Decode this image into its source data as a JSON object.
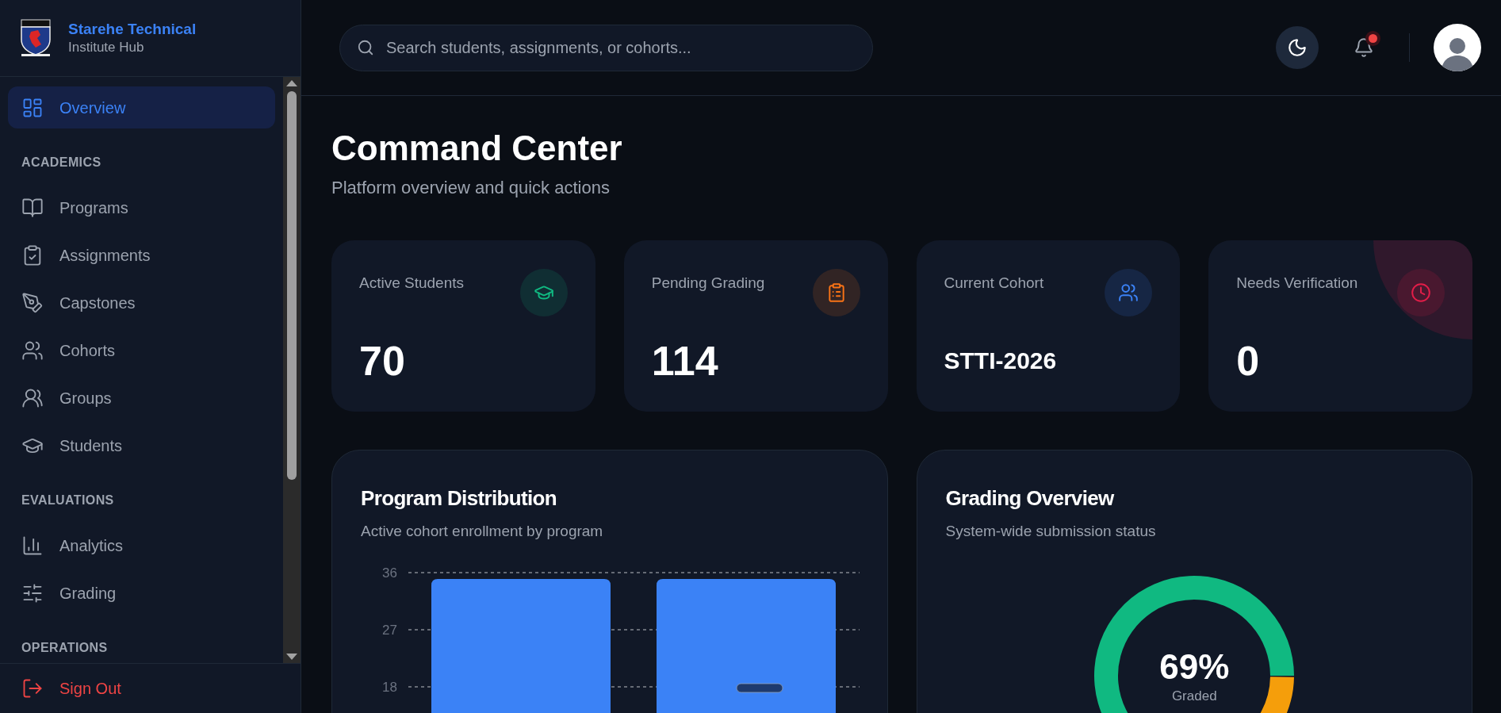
{
  "sidebar": {
    "brand": {
      "title": "Starehe Technical",
      "subtitle": "Institute Hub"
    },
    "nav": [
      {
        "kind": "item",
        "label": "Overview",
        "selected": true
      },
      {
        "kind": "heading",
        "label": "ACADEMICS"
      },
      {
        "kind": "item",
        "label": "Programs",
        "selected": false
      },
      {
        "kind": "item",
        "label": "Assignments",
        "selected": false
      },
      {
        "kind": "item",
        "label": "Capstones",
        "selected": false
      },
      {
        "kind": "item",
        "label": "Cohorts",
        "selected": false
      },
      {
        "kind": "item",
        "label": "Groups",
        "selected": false
      },
      {
        "kind": "item",
        "label": "Students",
        "selected": false
      },
      {
        "kind": "heading",
        "label": "EVALUATIONS"
      },
      {
        "kind": "item",
        "label": "Analytics",
        "selected": false
      },
      {
        "kind": "item",
        "label": "Grading",
        "selected": false
      },
      {
        "kind": "heading",
        "label": "OPERATIONS"
      }
    ],
    "sign_out": {
      "label": "Sign Out"
    }
  },
  "header": {
    "search": {
      "placeholder": "Search students, assignments, or cohorts..."
    },
    "notifications": {
      "unread": true
    }
  },
  "page": {
    "title": "Command Center",
    "subtitle": "Platform overview and quick actions"
  },
  "stats": [
    {
      "label": "Active Students",
      "value": "70",
      "kind": "number",
      "color": "#10b981",
      "glow": false
    },
    {
      "label": "Pending Grading",
      "value": "114",
      "kind": "number",
      "color": "#f97316",
      "glow": false
    },
    {
      "label": "Current Cohort",
      "value": "STTI-2026",
      "kind": "code",
      "color": "#3b82f6",
      "glow": false
    },
    {
      "label": "Needs Verification",
      "value": "0",
      "kind": "number",
      "color": "#e11d48",
      "glow": true
    }
  ],
  "charts": [
    {
      "title": "Program Distribution",
      "subtitle": "Active cohort enrollment by program",
      "chart_data": {
        "type": "bar",
        "values": [
          35,
          35
        ],
        "ylim": [
          0,
          36
        ],
        "yticks": [
          18,
          27,
          36
        ]
      }
    },
    {
      "title": "Grading Overview",
      "subtitle": "System-wide submission status",
      "center_value": "69%",
      "center_label": "Graded",
      "chart_data": {
        "type": "donut",
        "values": [
          69,
          31
        ]
      }
    }
  ]
}
